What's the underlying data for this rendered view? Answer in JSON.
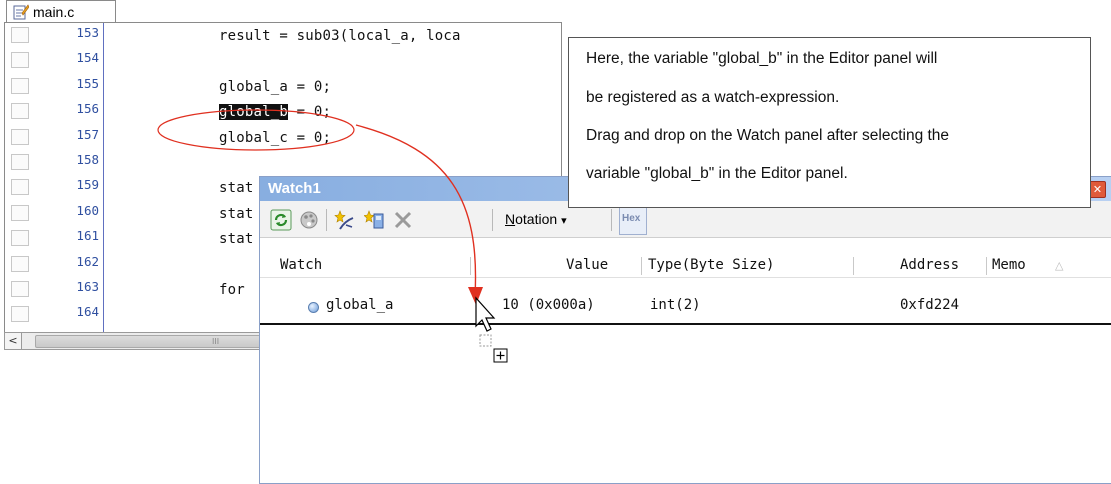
{
  "editor": {
    "tab_label": "main.c",
    "lines": [
      {
        "num": "153",
        "code": "result = sub03(local_a, loca"
      },
      {
        "num": "154",
        "code": ""
      },
      {
        "num": "155",
        "code": "global_a = 0;"
      },
      {
        "num": "156",
        "code": "global_b = 0;",
        "highlight": "global_b"
      },
      {
        "num": "157",
        "code": "global_c = 0;"
      },
      {
        "num": "158",
        "code": ""
      },
      {
        "num": "159",
        "code": "stat"
      },
      {
        "num": "160",
        "code": "stat"
      },
      {
        "num": "161",
        "code": "stat"
      },
      {
        "num": "162",
        "code": ""
      },
      {
        "num": "163",
        "code": "for"
      },
      {
        "num": "164",
        "code": ""
      }
    ],
    "scroll_left_arrow": "<",
    "scroll_grip": "III"
  },
  "watch": {
    "title": "Watch1",
    "close_glyph": "✕",
    "toolbar": {
      "notation_label": "Notation",
      "notation_mnemonic": "N",
      "notation_rest": "otation",
      "dropdown_glyph": "▾",
      "hex_label": "Hex",
      "delete_glyph": "✕"
    },
    "columns": {
      "watch": "Watch",
      "value": "Value",
      "type": "Type(Byte Size)",
      "address": "Address",
      "memo": "Memo",
      "sort_glyph": "△"
    },
    "rows": [
      {
        "name": "global_a",
        "value": "10 (0x000a)",
        "type": "int(2)",
        "address": "0xfd224"
      }
    ]
  },
  "callout": {
    "lines": [
      "Here, the variable \"global_b\" in the Editor panel will",
      "be registered as a watch-expression.",
      "Drag and drop on the Watch panel after selecting the",
      "variable \"global_b\" in the Editor panel."
    ]
  },
  "colors": {
    "annotation_red": "#e03020",
    "title_bar_start": "#88aee0",
    "title_bar_end": "#b8d0f2",
    "line_number_blue": "#3050a0"
  }
}
